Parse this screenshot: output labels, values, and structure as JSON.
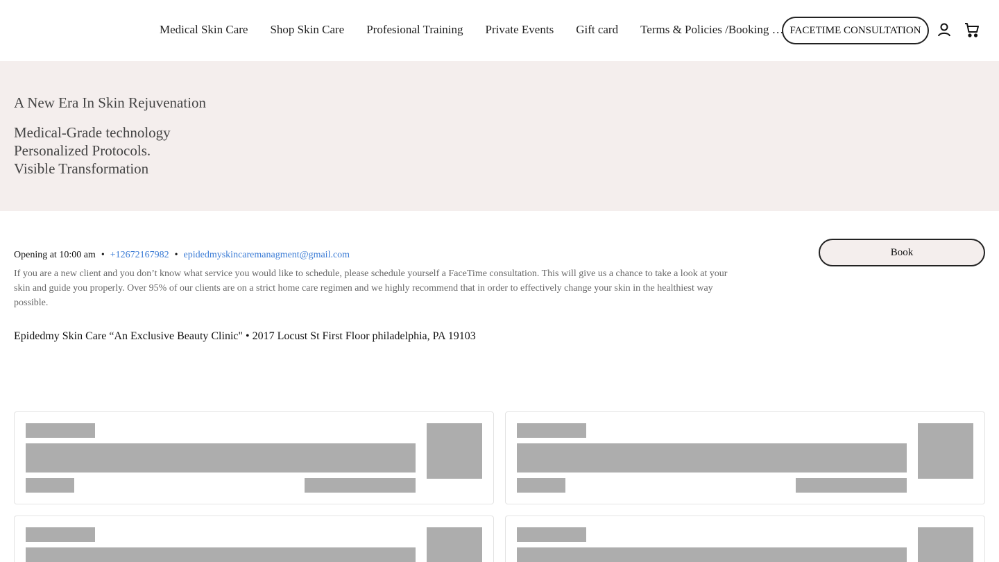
{
  "nav": {
    "items": [
      "Medical Skin Care",
      "Shop Skin Care",
      "Profesional Training",
      "Private Events",
      "Gift card",
      "Terms & Policies /Booking / Cancellation"
    ],
    "cta": "FACETIME CONSULTATION",
    "icons": [
      "account-icon",
      "cart-icon"
    ]
  },
  "hero": {
    "title": "A New Era In Skin Rejuvenation",
    "lines": [
      "Medical-Grade technology",
      "Personalized Protocols.",
      "Visible Transformation"
    ]
  },
  "info": {
    "opening": "Opening at 10:00 am",
    "separator": "•",
    "phone": "+12672167982",
    "email": "epidedmyskincaremanagment@gmail.com",
    "description": "If you are a new client and you don’t know what service you would like to schedule, please schedule yourself a FaceTime consultation. This will give us a chance to take a look at your skin and guide you properly. Over 95% of our clients are on a strict home care regimen and we highly recommend that in order to effectively change your skin in the healthiest way possible.",
    "address": "Epidedmy Skin Care “An Exclusive Beauty Clinic\" • 2017 Locust St First Floor philadelphia, PA 19103",
    "book_label": "Book"
  },
  "colors": {
    "hero_bg": "#f4eeed",
    "link": "#3a7bd5",
    "skeleton": "#adadad"
  }
}
